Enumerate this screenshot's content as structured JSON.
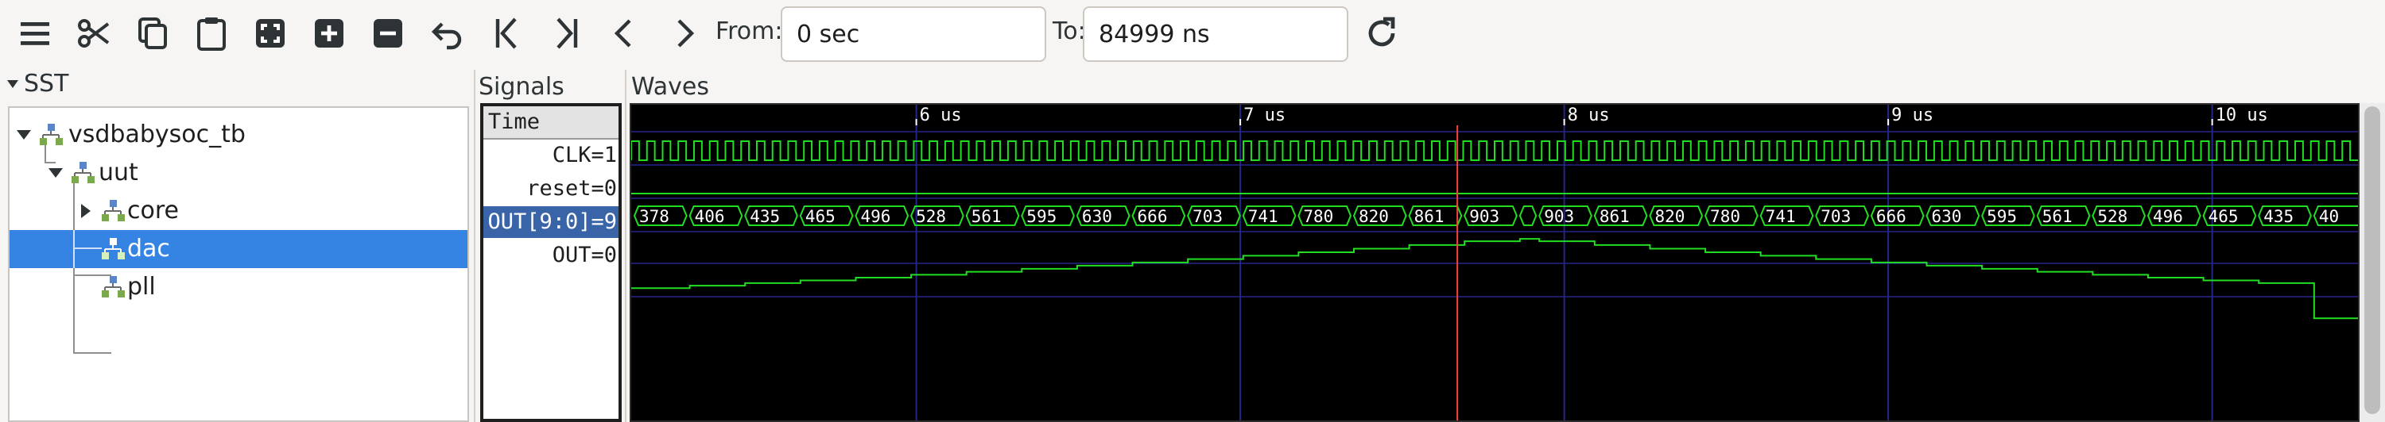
{
  "toolbar": {
    "from_label": "From:",
    "from_value": "0 sec",
    "to_label": "To:",
    "to_value": "84999 ns",
    "icons": [
      "menu-icon",
      "cut-icon",
      "copy-icon",
      "paste-icon",
      "zoom-fit-icon",
      "zoom-in-icon",
      "zoom-out-icon",
      "undo-zoom-icon",
      "jump-start-icon",
      "jump-end-icon",
      "prev-edge-icon",
      "next-edge-icon",
      "reload-icon"
    ]
  },
  "sst": {
    "title": "SST",
    "tree": [
      {
        "label": "vsdbabysoc_tb",
        "expanded": true,
        "selected": false
      },
      {
        "label": "uut",
        "expanded": true,
        "selected": false
      },
      {
        "label": "core",
        "expanded": false,
        "selected": false
      },
      {
        "label": "dac",
        "selected": true
      },
      {
        "label": "pll",
        "selected": false
      }
    ]
  },
  "signals": {
    "title": "Signals",
    "header": "Time",
    "items": [
      {
        "name": "CLK",
        "value": "=1",
        "selected": false
      },
      {
        "name": "reset",
        "value": "=0",
        "selected": false
      },
      {
        "name": "OUT[9:0]",
        "value": "=9",
        "selected": true
      },
      {
        "name": "OUT",
        "value": "=0",
        "selected": false
      }
    ]
  },
  "waves": {
    "title": "Waves",
    "time_ticks": [
      "6 us",
      "7 us",
      "8 us",
      "9 us",
      "10 us"
    ],
    "time_tick_values_us": [
      6,
      7,
      8,
      9,
      10
    ],
    "view_start_us": 5.12,
    "view_end_us": 10.45,
    "cursor_us": 7.67,
    "bus_values": [
      "378",
      "406",
      "435",
      "465",
      "496",
      "528",
      "561",
      "595",
      "630",
      "666",
      "703",
      "741",
      "780",
      "820",
      "861",
      "903",
      "",
      "903",
      "861",
      "820",
      "780",
      "741",
      "703",
      "666",
      "630",
      "595",
      "561",
      "528",
      "496",
      "465",
      "435",
      "40"
    ],
    "clock_periods": 110,
    "colors": {
      "wave": "#22dd22",
      "cursor": "#ff4040",
      "grid": "#26268a",
      "background": "#000000",
      "selection": "#3584e4"
    }
  }
}
